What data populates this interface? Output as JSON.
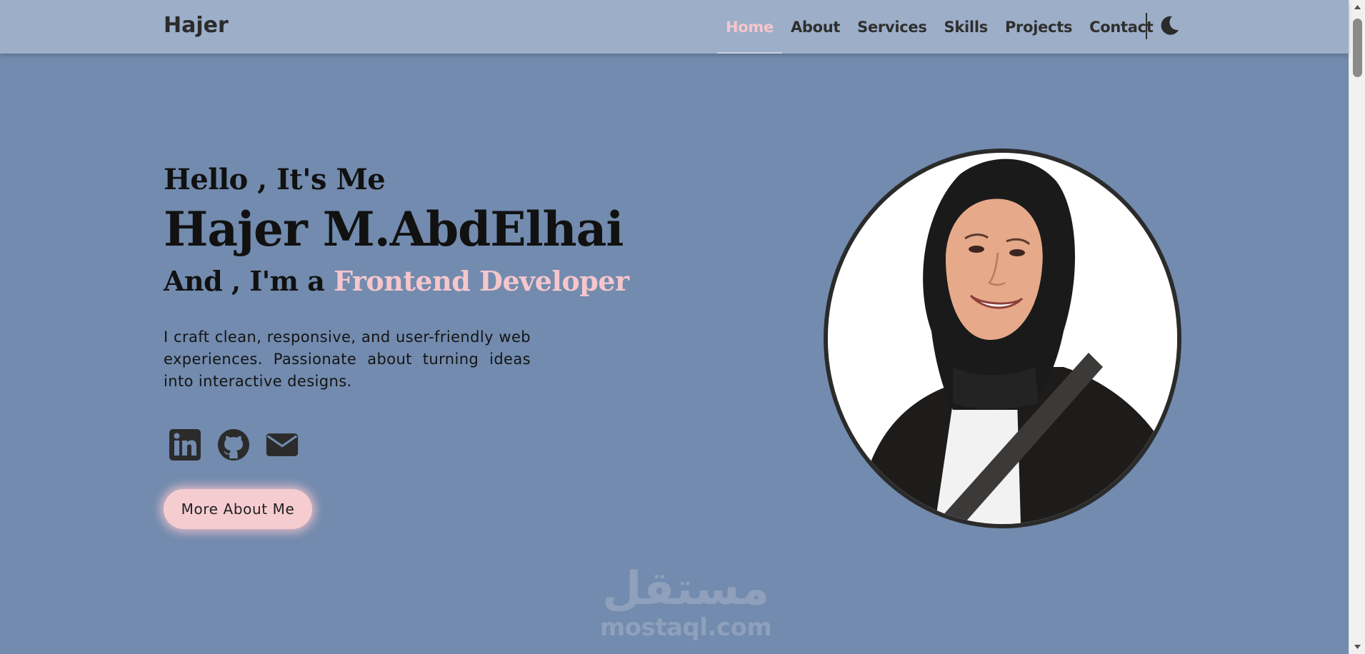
{
  "navbar": {
    "brand": "Hajer",
    "links": [
      {
        "label": "Home",
        "active": true
      },
      {
        "label": "About",
        "active": false
      },
      {
        "label": "Services",
        "active": false
      },
      {
        "label": "Skills",
        "active": false
      },
      {
        "label": "Projects",
        "active": false
      },
      {
        "label": "Contact",
        "active": false
      }
    ],
    "theme_toggle_icon": "moon-icon"
  },
  "hero": {
    "greeting": "Hello , It's Me",
    "name": "Hajer M.AbdElhai",
    "role_prefix": "And , I'm a ",
    "role": "Frontend Developer",
    "bio": "I craft clean, responsive, and user-friendly web experiences. Passionate about turning ideas into interactive designs.",
    "socials": [
      {
        "icon": "linkedin-icon"
      },
      {
        "icon": "github-icon"
      },
      {
        "icon": "envelope-icon"
      }
    ],
    "cta_label": "More About Me",
    "portrait_icon": "profile-photo"
  },
  "watermark": {
    "arabic": "مستقل",
    "latin": "mostaql.com"
  },
  "colors": {
    "background": "#728bae",
    "navbar": "#9caec8",
    "accent": "#f5c6cc",
    "text": "#111111"
  }
}
